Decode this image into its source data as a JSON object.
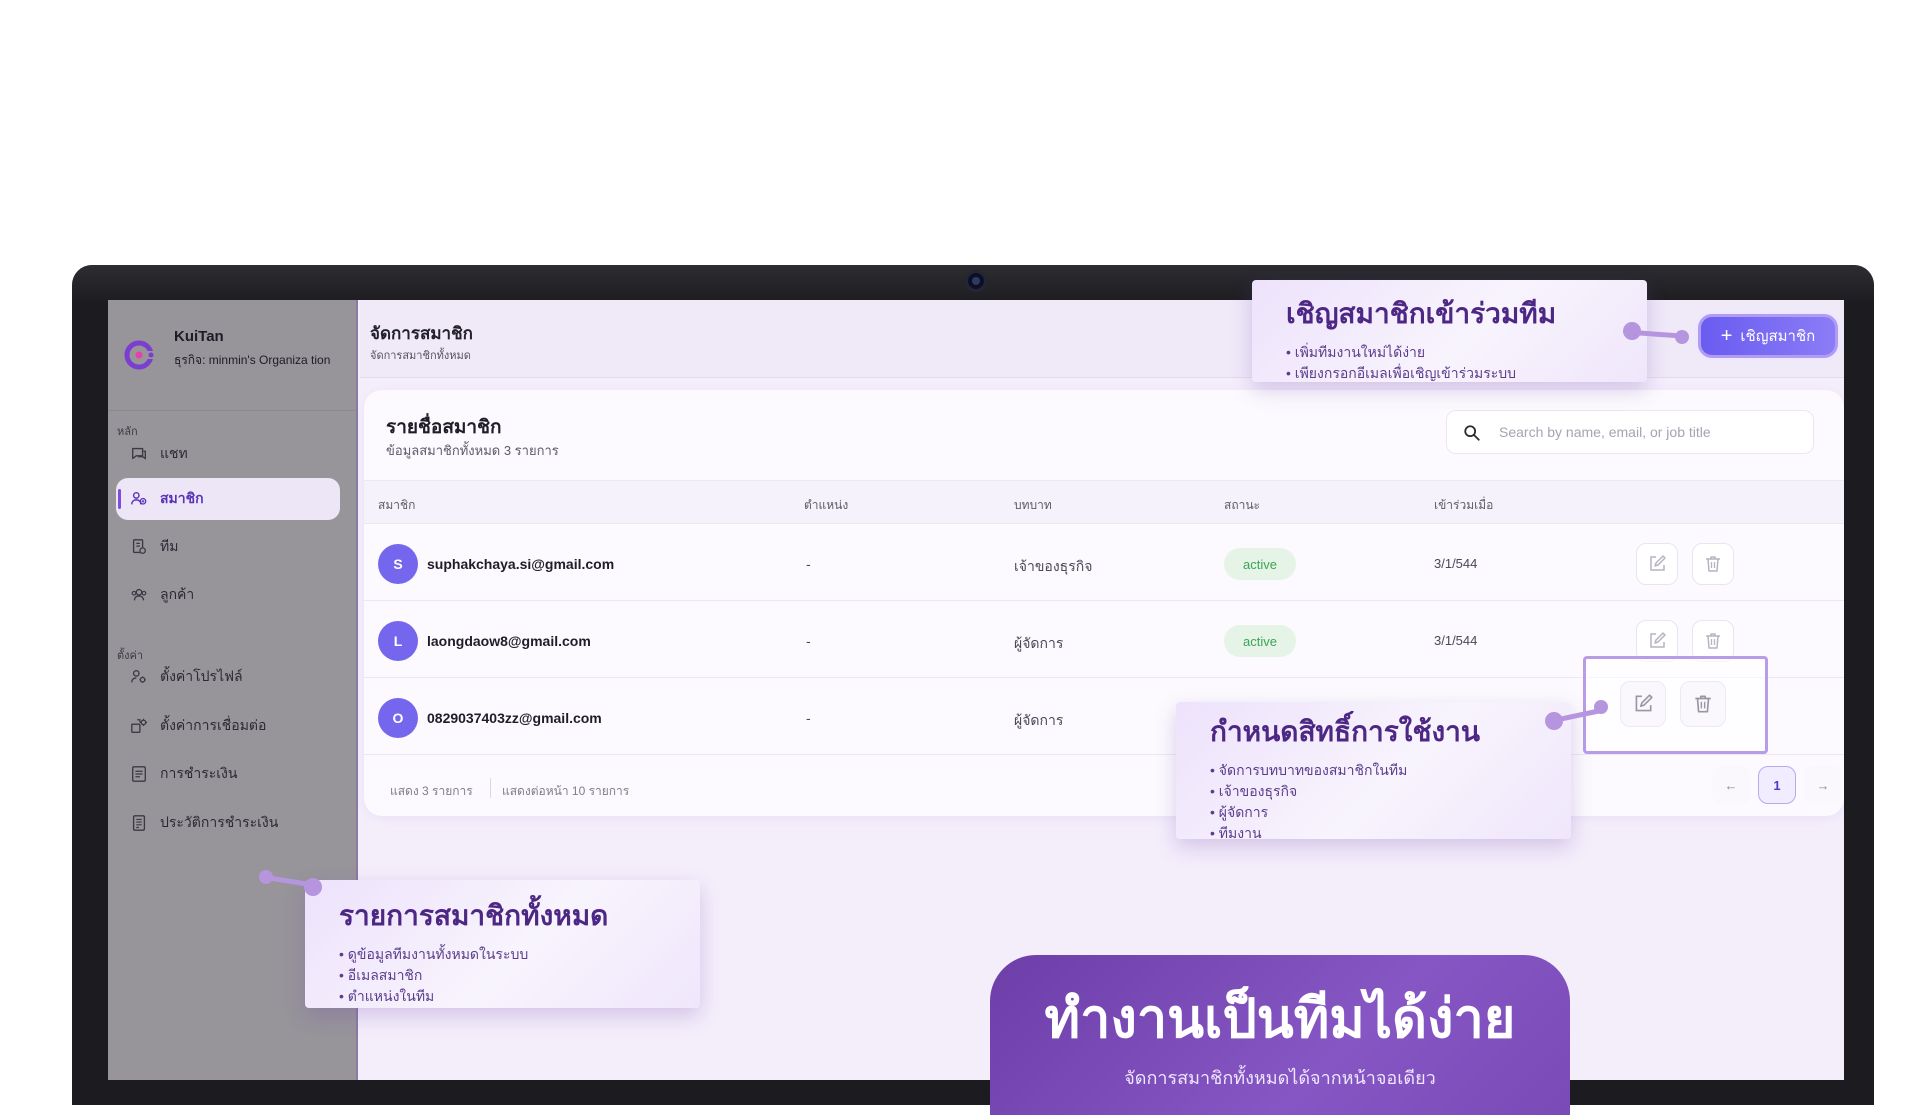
{
  "app": {
    "name": "KuiTan",
    "org": "ธุรกิจ: minmin's Organiza tion"
  },
  "sidebar": {
    "section_main": "หลัก",
    "section_settings": "ตั้งค่า",
    "items": [
      {
        "label": "แชท",
        "icon": "chat-icon"
      },
      {
        "label": "สมาชิก",
        "icon": "members-icon",
        "active": true
      },
      {
        "label": "ทีม",
        "icon": "team-icon"
      },
      {
        "label": "ลูกค้า",
        "icon": "customers-icon"
      },
      {
        "label": "ตั้งค่าโปรไฟล์",
        "icon": "profile-settings-icon"
      },
      {
        "label": "ตั้งค่าการเชื่อมต่อ",
        "icon": "connection-settings-icon"
      },
      {
        "label": "การชำระเงิน",
        "icon": "payment-icon"
      },
      {
        "label": "ประวัติการชำระเงิน",
        "icon": "payment-history-icon"
      }
    ]
  },
  "header": {
    "title": "จัดการสมาชิก",
    "subtitle": "จัดการสมาชิกทั้งหมด",
    "invite_label": "เชิญสมาชิก"
  },
  "panel": {
    "title": "รายชื่อสมาชิก",
    "subtitle": "ข้อมูลสมาชิกทั้งหมด 3 รายการ",
    "search_placeholder": "Search by name, email, or job title",
    "columns": [
      "สมาชิก",
      "ตำแหน่ง",
      "บทบาท",
      "สถานะ",
      "เข้าร่วมเมื่อ"
    ],
    "rows": [
      {
        "initial": "S",
        "email": "suphakchaya.si@gmail.com",
        "position": "-",
        "role": "เจ้าของธุรกิจ",
        "status": "active",
        "joined": "3/1/544"
      },
      {
        "initial": "L",
        "email": "laongdaow8@gmail.com",
        "position": "-",
        "role": "ผู้จัดการ",
        "status": "active",
        "joined": "3/1/544"
      },
      {
        "initial": "O",
        "email": "0829037403zz@gmail.com",
        "position": "-",
        "role": "ผู้จัดการ",
        "status": "",
        "joined": ""
      }
    ],
    "footer_count": "แสดง 3 รายการ",
    "footer_per_page": "แสดงต่อหน้า 10 รายการ",
    "pagination": {
      "prev": "←",
      "current": "1",
      "next": "→"
    }
  },
  "callouts": {
    "invite": {
      "title": "เชิญสมาชิกเข้าร่วมทีม",
      "points": [
        "เพิ่มทีมงานใหม่ได้ง่าย",
        "เพียงกรอกอีเมลเพื่อเชิญเข้าร่วมระบบ"
      ]
    },
    "permissions": {
      "title": "กำหนดสิทธิ์การใช้งาน",
      "points": [
        "จัดการบทบาทของสมาชิกในทีม",
        "เจ้าของธุรกิจ",
        "ผู้จัดการ",
        "ทีมงาน"
      ]
    },
    "member_list": {
      "title": "รายการสมาชิกทั้งหมด",
      "points": [
        "ดูข้อมูลทีมงานทั้งหมดในระบบ",
        "อีเมลสมาชิก",
        "ตำแหน่งในทีม"
      ]
    }
  },
  "hero": {
    "title": "ทำงานเป็นทีมได้ง่าย",
    "subtitle": "จัดการสมาชิกทั้งหมดได้จากหน้าจอเดียว"
  },
  "colors": {
    "accent": "#7c4dde",
    "invite_button": "#6a5cf0",
    "avatar": "#7467ee",
    "status_active": "#3aa655",
    "hero": "#6d3ea8"
  }
}
